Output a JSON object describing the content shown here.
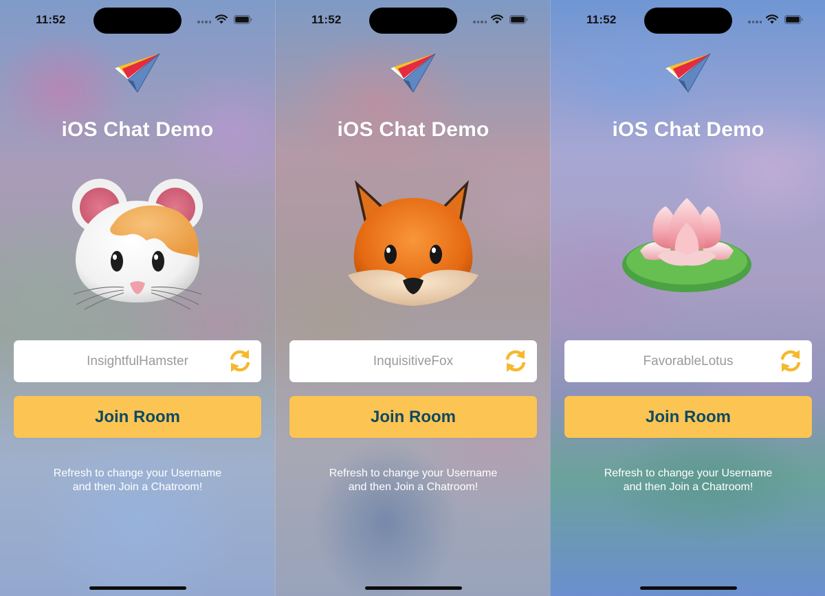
{
  "screens": [
    {
      "status_time": "11:52",
      "app_title": "iOS Chat Demo",
      "avatar_icon": "hamster-face-icon",
      "username": "InsightfulHamster",
      "join_label": "Join Room",
      "hint_line1": "Refresh to change your Username",
      "hint_line2": "and then Join a Chatroom!"
    },
    {
      "status_time": "11:52",
      "app_title": "iOS Chat Demo",
      "avatar_icon": "fox-face-icon",
      "username": "InquisitiveFox",
      "join_label": "Join Room",
      "hint_line1": "Refresh to change your Username",
      "hint_line2": "and then Join a Chatroom!"
    },
    {
      "status_time": "11:52",
      "app_title": "iOS Chat Demo",
      "avatar_icon": "lotus-icon",
      "username": "FavorableLotus",
      "join_label": "Join Room",
      "hint_line1": "Refresh to change your Username",
      "hint_line2": "and then Join a Chatroom!"
    }
  ],
  "colors": {
    "accent": "#fcc453",
    "button_text": "#0e4a62",
    "refresh_icon": "#f5b82e",
    "placeholder_text": "#9a9a9a"
  }
}
